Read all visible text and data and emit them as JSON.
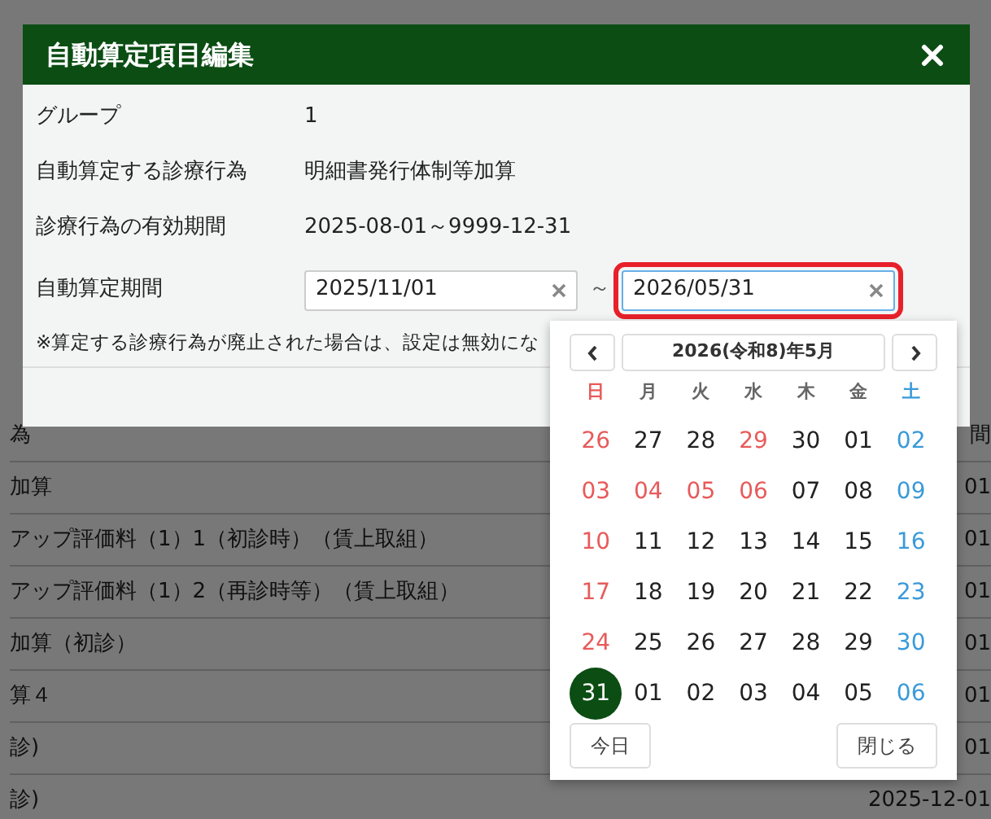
{
  "background_table": {
    "rows": [
      {
        "column_1": "為",
        "column_2": "間"
      },
      {
        "column_1": "加算",
        "column_2": "01"
      },
      {
        "column_1": "アップ評価料（1）1（初診時）（賃上取組）",
        "column_2": "01"
      },
      {
        "column_1": "アップ評価料（1）2（再診時等）（賃上取組）",
        "column_2": "01"
      },
      {
        "column_1": "加算（初診）",
        "column_2": "01"
      },
      {
        "column_1": "算４",
        "column_2": "01"
      },
      {
        "column_1": "診)",
        "column_2": "01"
      },
      {
        "column_1": "診)",
        "column_2": "2025-12-01"
      }
    ]
  },
  "dialog": {
    "title": "自動算定項目編集",
    "fields": [
      {
        "kind": "text",
        "label": "グループ",
        "value": "1"
      },
      {
        "kind": "text",
        "label": "自動算定する診療行為",
        "value": "明細書発行体制等加算"
      },
      {
        "kind": "text",
        "label": "診療行為の有効期間",
        "value": "2025-08-01～9999-12-31"
      },
      {
        "kind": "date_range",
        "label": "自動算定期間",
        "separator": "～",
        "from": {
          "value": "2025/11/01",
          "focused": false
        },
        "to": {
          "value": "2026/05/31",
          "focused": true
        }
      }
    ],
    "note": "※算定する診療行為が廃止された場合は、設定は無効にな"
  },
  "calendar": {
    "month_label": "2026(令和8)年5月",
    "weekdays": [
      {
        "text": "日",
        "kind": "sun"
      },
      {
        "text": "月",
        "kind": "day"
      },
      {
        "text": "火",
        "kind": "day"
      },
      {
        "text": "水",
        "kind": "day"
      },
      {
        "text": "木",
        "kind": "day"
      },
      {
        "text": "金",
        "kind": "day"
      },
      {
        "text": "土",
        "kind": "sat"
      }
    ],
    "weeks": [
      [
        {
          "text": "26",
          "kind": "sun",
          "selected": false
        },
        {
          "text": "27",
          "kind": "day",
          "selected": false
        },
        {
          "text": "28",
          "kind": "day",
          "selected": false
        },
        {
          "text": "29",
          "kind": "holiday",
          "selected": false
        },
        {
          "text": "30",
          "kind": "day",
          "selected": false
        },
        {
          "text": "01",
          "kind": "day",
          "selected": false
        },
        {
          "text": "02",
          "kind": "sat",
          "selected": false
        }
      ],
      [
        {
          "text": "03",
          "kind": "sun",
          "selected": false
        },
        {
          "text": "04",
          "kind": "holiday",
          "selected": false
        },
        {
          "text": "05",
          "kind": "holiday",
          "selected": false
        },
        {
          "text": "06",
          "kind": "holiday",
          "selected": false
        },
        {
          "text": "07",
          "kind": "day",
          "selected": false
        },
        {
          "text": "08",
          "kind": "day",
          "selected": false
        },
        {
          "text": "09",
          "kind": "sat",
          "selected": false
        }
      ],
      [
        {
          "text": "10",
          "kind": "sun",
          "selected": false
        },
        {
          "text": "11",
          "kind": "day",
          "selected": false
        },
        {
          "text": "12",
          "kind": "day",
          "selected": false
        },
        {
          "text": "13",
          "kind": "day",
          "selected": false
        },
        {
          "text": "14",
          "kind": "day",
          "selected": false
        },
        {
          "text": "15",
          "kind": "day",
          "selected": false
        },
        {
          "text": "16",
          "kind": "sat",
          "selected": false
        }
      ],
      [
        {
          "text": "17",
          "kind": "sun",
          "selected": false
        },
        {
          "text": "18",
          "kind": "day",
          "selected": false
        },
        {
          "text": "19",
          "kind": "day",
          "selected": false
        },
        {
          "text": "20",
          "kind": "day",
          "selected": false
        },
        {
          "text": "21",
          "kind": "day",
          "selected": false
        },
        {
          "text": "22",
          "kind": "day",
          "selected": false
        },
        {
          "text": "23",
          "kind": "sat",
          "selected": false
        }
      ],
      [
        {
          "text": "24",
          "kind": "sun",
          "selected": false
        },
        {
          "text": "25",
          "kind": "day",
          "selected": false
        },
        {
          "text": "26",
          "kind": "day",
          "selected": false
        },
        {
          "text": "27",
          "kind": "day",
          "selected": false
        },
        {
          "text": "28",
          "kind": "day",
          "selected": false
        },
        {
          "text": "29",
          "kind": "day",
          "selected": false
        },
        {
          "text": "30",
          "kind": "sat",
          "selected": false
        }
      ],
      [
        {
          "text": "31",
          "kind": "sun",
          "selected": true
        },
        {
          "text": "01",
          "kind": "day",
          "selected": false
        },
        {
          "text": "02",
          "kind": "day",
          "selected": false
        },
        {
          "text": "03",
          "kind": "day",
          "selected": false
        },
        {
          "text": "04",
          "kind": "day",
          "selected": false
        },
        {
          "text": "05",
          "kind": "day",
          "selected": false
        },
        {
          "text": "06",
          "kind": "sat",
          "selected": false
        }
      ]
    ],
    "buttons": [
      "今日",
      "閉じる"
    ]
  }
}
